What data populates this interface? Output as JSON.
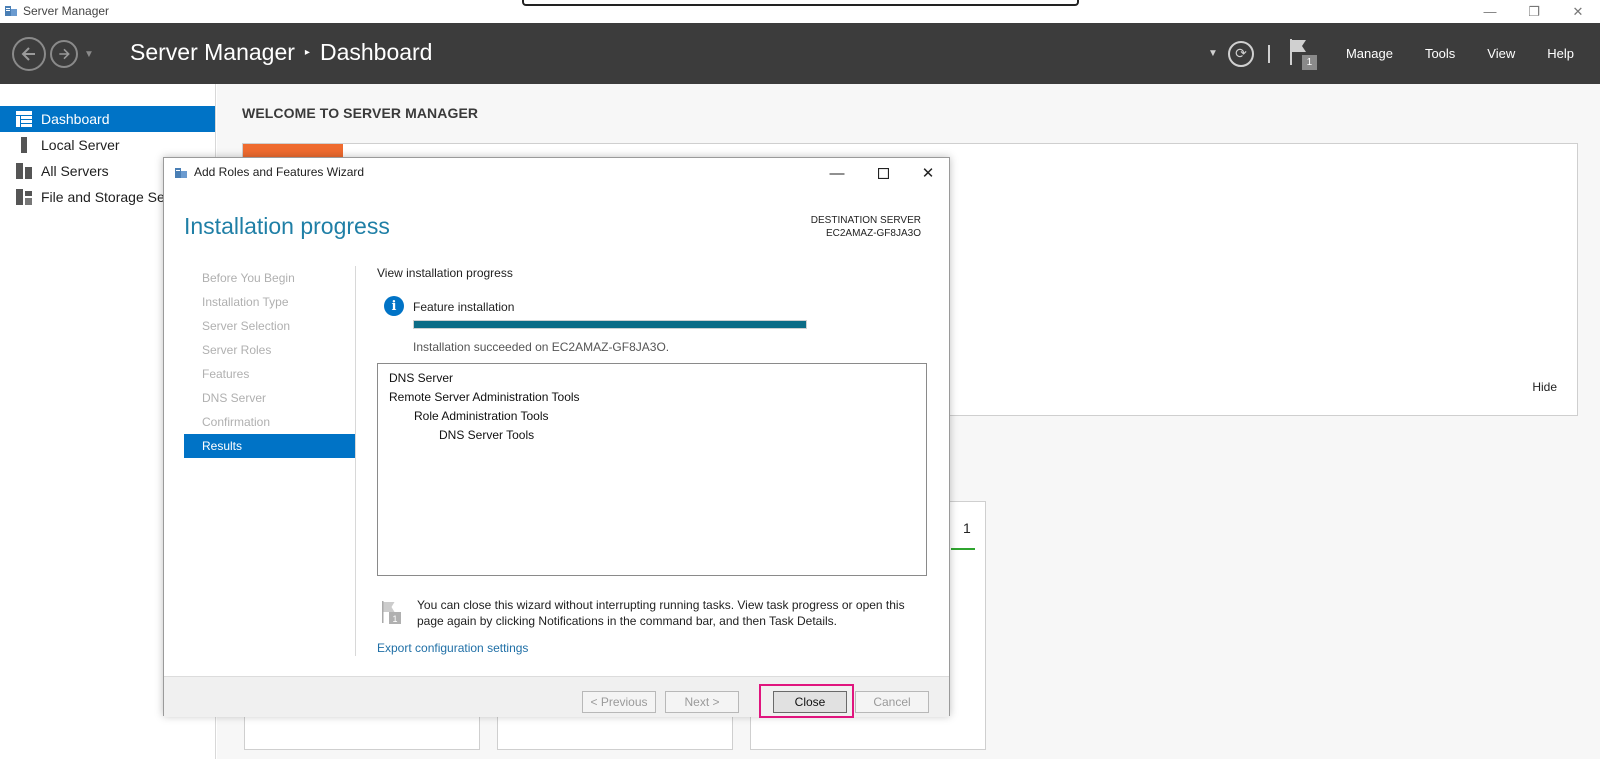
{
  "window": {
    "title": "Server Manager",
    "icon": "server-manager-icon",
    "controls": {
      "minimize": "—",
      "restore": "❐",
      "close": "✕"
    }
  },
  "header": {
    "breadcrumb_app": "Server Manager",
    "breadcrumb_sep": "▸",
    "breadcrumb_page": "Dashboard",
    "notification_count": "1",
    "menu": [
      "Manage",
      "Tools",
      "View",
      "Help"
    ]
  },
  "sidebar": {
    "items": [
      {
        "label": "Dashboard",
        "icon": "dashboard-icon",
        "active": true
      },
      {
        "label": "Local Server",
        "icon": "server-icon",
        "active": false
      },
      {
        "label": "All Servers",
        "icon": "servers-icon",
        "active": false
      },
      {
        "label": "File and Storage Ser",
        "icon": "storage-icon",
        "active": false
      }
    ]
  },
  "main": {
    "welcome_title": "WELCOME TO SERVER MANAGER",
    "hide_label": "Hide",
    "tile_count": "1"
  },
  "wizard": {
    "title": "Add Roles and Features Wizard",
    "heading": "Installation progress",
    "destination_label": "DESTINATION SERVER",
    "destination_server": "EC2AMAZ-GF8JA3O",
    "steps": [
      {
        "label": "Before You Begin",
        "active": false
      },
      {
        "label": "Installation Type",
        "active": false
      },
      {
        "label": "Server Selection",
        "active": false
      },
      {
        "label": "Server Roles",
        "active": false
      },
      {
        "label": "Features",
        "active": false
      },
      {
        "label": "DNS Server",
        "active": false
      },
      {
        "label": "Confirmation",
        "active": false
      },
      {
        "label": "Results",
        "active": true
      }
    ],
    "view_label": "View installation progress",
    "feature_label": "Feature installation",
    "progress_percent": 100,
    "result_message": "Installation succeeded on EC2AMAZ-GF8JA3O.",
    "results": [
      {
        "text": "DNS Server",
        "level": 0
      },
      {
        "text": "Remote Server Administration Tools",
        "level": 0
      },
      {
        "text": "Role Administration Tools",
        "level": 1
      },
      {
        "text": "DNS Server Tools",
        "level": 2
      }
    ],
    "note": "You can close this wizard without interrupting running tasks. View task progress or open this page again by clicking Notifications in the command bar, and then Task Details.",
    "note_badge": "1",
    "export_link": "Export configuration settings",
    "buttons": {
      "previous": "< Previous",
      "next": "Next >",
      "close": "Close",
      "cancel": "Cancel"
    },
    "colors": {
      "accent": "#0073c6",
      "progress": "#0c6c86",
      "highlight": "#e0157e"
    }
  }
}
